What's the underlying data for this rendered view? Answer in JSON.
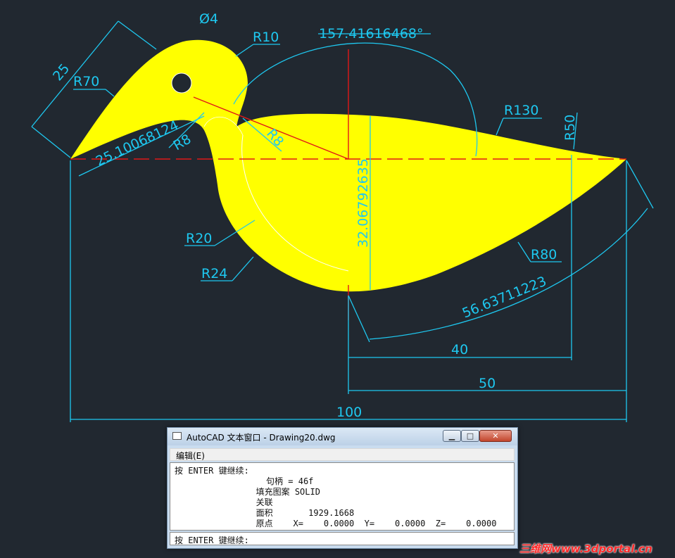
{
  "drawing": {
    "dimensions": {
      "d_hole": "Ø4",
      "r10": "R10",
      "angle": "157.41616468°",
      "r70": "R70",
      "d25": "25",
      "len_beak": "25.10068124",
      "r8_a": "R8",
      "r8_b": "R8",
      "r130": "R130",
      "r50": "R50",
      "height": "32.06792635",
      "r20": "R20",
      "r24": "R24",
      "r80": "R80",
      "arc_len": "56.63711223",
      "d40": "40",
      "d50": "50",
      "d100": "100"
    },
    "colors": {
      "background": "#212830",
      "fill": "#ffff00",
      "dimension": "#1ec8f0",
      "centerline": "#e01818"
    }
  },
  "text_window": {
    "title": "AutoCAD 文本窗口 - Drawing20.dwg",
    "buttons": {
      "minimize": "▁",
      "maximize": "□",
      "close": "✕"
    },
    "menu": "编辑(E)",
    "lines": [
      "按 ENTER 键继续:",
      "                  句柄 = 46f",
      "                填充图案 SOLID",
      "                关联",
      "                面积       1929.1668",
      "                原点    X=    0.0000  Y=    0.0000  Z=    0.0000"
    ],
    "command_prompt": "按 ENTER 键继续:"
  },
  "watermark": "三维网www.3dportal.cn"
}
